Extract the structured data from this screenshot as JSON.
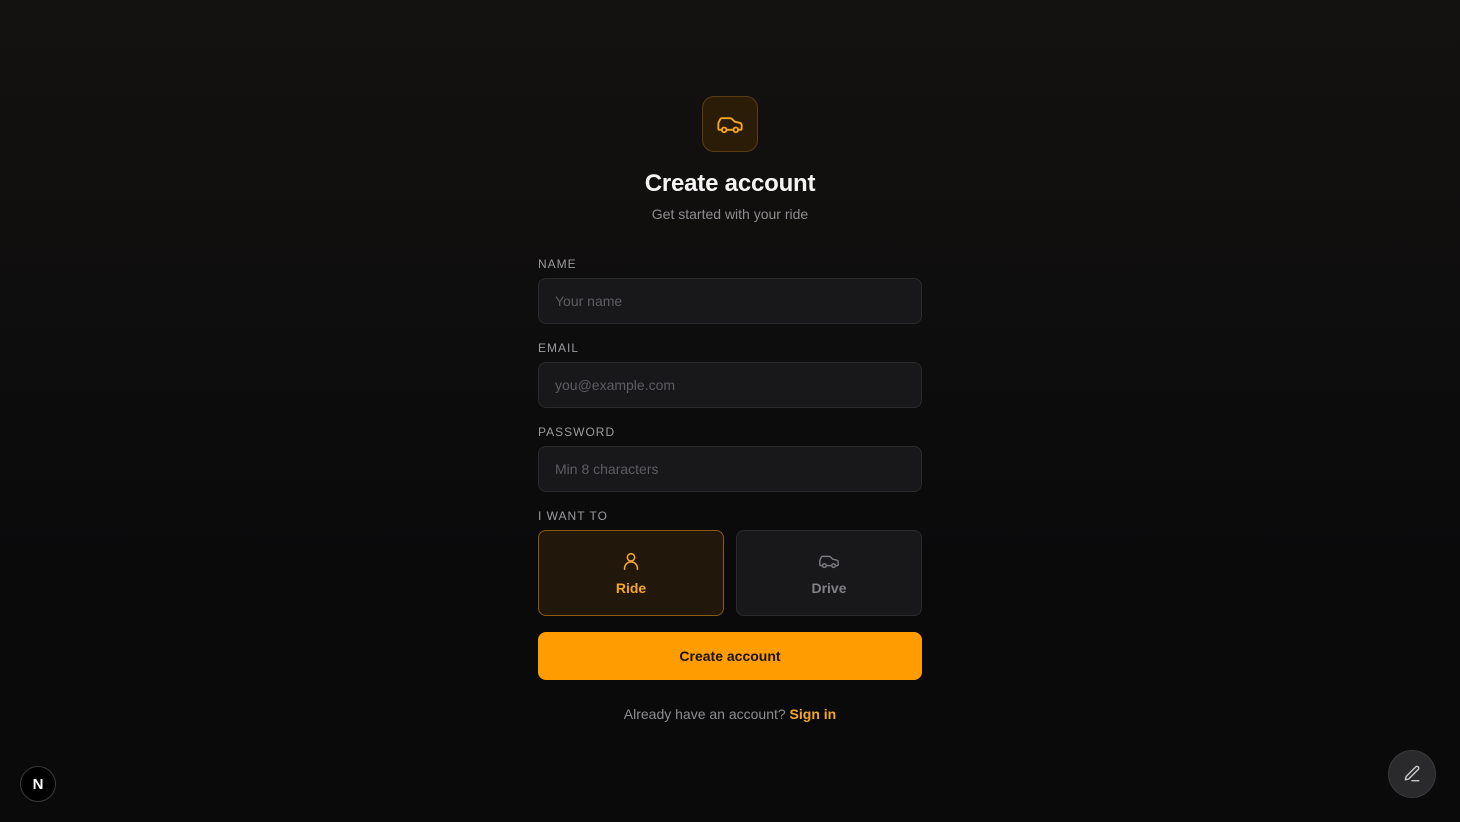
{
  "header": {
    "logo_icon": "car-icon",
    "title": "Create account",
    "subtitle": "Get started with your ride"
  },
  "form": {
    "name": {
      "label": "NAME",
      "placeholder": "Your name",
      "value": ""
    },
    "email": {
      "label": "EMAIL",
      "placeholder": "you@example.com",
      "value": ""
    },
    "password": {
      "label": "PASSWORD",
      "placeholder": "Min 8 characters",
      "value": ""
    },
    "role": {
      "label": "I WANT TO",
      "selected": "Ride",
      "options": [
        {
          "label": "Ride",
          "icon": "user-icon"
        },
        {
          "label": "Drive",
          "icon": "car-icon"
        }
      ]
    },
    "submit_label": "Create account"
  },
  "footer": {
    "prompt": "Already have an account?",
    "signin_label": "Sign in"
  },
  "overlays": {
    "dev_badge_letter": "N",
    "edit_button_icon": "pencil-icon"
  },
  "colors": {
    "accent": "#ff9d00",
    "accent_text": "#f5a623",
    "background": "#0a0a0b"
  }
}
